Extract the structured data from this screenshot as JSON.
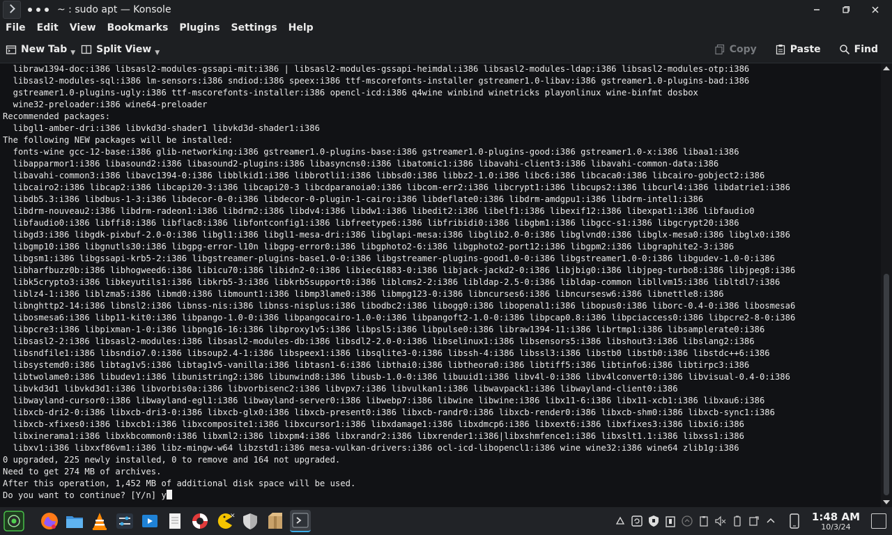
{
  "window": {
    "title": "~ : sudo apt — Konsole"
  },
  "menubar": {
    "items": [
      "File",
      "Edit",
      "View",
      "Bookmarks",
      "Plugins",
      "Settings",
      "Help"
    ]
  },
  "toolbar": {
    "new_tab": "New Tab",
    "split_view": "Split View",
    "copy": "Copy",
    "paste": "Paste",
    "find": "Find"
  },
  "terminal": {
    "lines": [
      "  libraw1394-doc:i386 libsasl2-modules-gssapi-mit:i386 | libsasl2-modules-gssapi-heimdal:i386 libsasl2-modules-ldap:i386 libsasl2-modules-otp:i386",
      "  libsasl2-modules-sql:i386 lm-sensors:i386 sndiod:i386 speex:i386 ttf-mscorefonts-installer gstreamer1.0-libav:i386 gstreamer1.0-plugins-bad:i386",
      "  gstreamer1.0-plugins-ugly:i386 ttf-mscorefonts-installer:i386 opencl-icd:i386 q4wine winbind winetricks playonlinux wine-binfmt dosbox",
      "  wine32-preloader:i386 wine64-preloader",
      "Recommended packages:",
      "  libgl1-amber-dri:i386 libvkd3d-shader1 libvkd3d-shader1:i386",
      "The following NEW packages will be installed:",
      "  fonts-wine gcc-12-base:i386 glib-networking:i386 gstreamer1.0-plugins-base:i386 gstreamer1.0-plugins-good:i386 gstreamer1.0-x:i386 libaa1:i386",
      "  libapparmor1:i386 libasound2:i386 libasound2-plugins:i386 libasyncns0:i386 libatomic1:i386 libavahi-client3:i386 libavahi-common-data:i386",
      "  libavahi-common3:i386 libavc1394-0:i386 libblkid1:i386 libbrotli1:i386 libbsd0:i386 libbz2-1.0:i386 libc6:i386 libcaca0:i386 libcairo-gobject2:i386",
      "  libcairo2:i386 libcap2:i386 libcapi20-3:i386 libcapi20-3 libcdparanoia0:i386 libcom-err2:i386 libcrypt1:i386 libcups2:i386 libcurl4:i386 libdatrie1:i386",
      "  libdb5.3:i386 libdbus-1-3:i386 libdecor-0-0:i386 libdecor-0-plugin-1-cairo:i386 libdeflate0:i386 libdrm-amdgpu1:i386 libdrm-intel1:i386",
      "  libdrm-nouveau2:i386 libdrm-radeon1:i386 libdrm2:i386 libdv4:i386 libdw1:i386 libedit2:i386 libelf1:i386 libexif12:i386 libexpat1:i386 libfaudio0",
      "  libfaudio0:i386 libffi8:i386 libflac8:i386 libfontconfig1:i386 libfreetype6:i386 libfribidi0:i386 libgbm1:i386 libgcc-s1:i386 libgcrypt20:i386",
      "  libgd3:i386 libgdk-pixbuf-2.0-0:i386 libgl1:i386 libgl1-mesa-dri:i386 libglapi-mesa:i386 libglib2.0-0:i386 libglvnd0:i386 libglx-mesa0:i386 libglx0:i386",
      "  libgmp10:i386 libgnutls30:i386 libgpg-error-l10n libgpg-error0:i386 libgphoto2-6:i386 libgphoto2-port12:i386 libgpm2:i386 libgraphite2-3:i386",
      "  libgsm1:i386 libgssapi-krb5-2:i386 libgstreamer-plugins-base1.0-0:i386 libgstreamer-plugins-good1.0-0:i386 libgstreamer1.0-0:i386 libgudev-1.0-0:i386",
      "  libharfbuzz0b:i386 libhogweed6:i386 libicu70:i386 libidn2-0:i386 libiec61883-0:i386 libjack-jackd2-0:i386 libjbig0:i386 libjpeg-turbo8:i386 libjpeg8:i386",
      "  libk5crypto3:i386 libkeyutils1:i386 libkrb5-3:i386 libkrb5support0:i386 liblcms2-2:i386 libldap-2.5-0:i386 libldap-common libllvm15:i386 libltdl7:i386",
      "  liblz4-1:i386 liblzma5:i386 libmd0:i386 libmount1:i386 libmp3lame0:i386 libmpg123-0:i386 libncurses6:i386 libncursesw6:i386 libnettle8:i386",
      "  libnghttp2-14:i386 libnsl2:i386 libnss-nis:i386 libnss-nisplus:i386 libodbc2:i386 libogg0:i386 libopenal1:i386 libopus0:i386 liborc-0.4-0:i386 libosmesa6",
      "  libosmesa6:i386 libp11-kit0:i386 libpango-1.0-0:i386 libpangocairo-1.0-0:i386 libpangoft2-1.0-0:i386 libpcap0.8:i386 libpciaccess0:i386 libpcre2-8-0:i386",
      "  libpcre3:i386 libpixman-1-0:i386 libpng16-16:i386 libproxy1v5:i386 libpsl5:i386 libpulse0:i386 libraw1394-11:i386 librtmp1:i386 libsamplerate0:i386",
      "  libsasl2-2:i386 libsasl2-modules:i386 libsasl2-modules-db:i386 libsdl2-2.0-0:i386 libselinux1:i386 libsensors5:i386 libshout3:i386 libslang2:i386",
      "  libsndfile1:i386 libsndio7.0:i386 libsoup2.4-1:i386 libspeex1:i386 libsqlite3-0:i386 libssh-4:i386 libssl3:i386 libstb0 libstb0:i386 libstdc++6:i386",
      "  libsystemd0:i386 libtag1v5:i386 libtag1v5-vanilla:i386 libtasn1-6:i386 libthai0:i386 libtheora0:i386 libtiff5:i386 libtinfo6:i386 libtirpc3:i386",
      "  libtwolame0:i386 libudev1:i386 libunistring2:i386 libunwind8:i386 libusb-1.0-0:i386 libuuid1:i386 libv4l-0:i386 libv4lconvert0:i386 libvisual-0.4-0:i386",
      "  libvkd3d1 libvkd3d1:i386 libvorbis0a:i386 libvorbisenc2:i386 libvpx7:i386 libvulkan1:i386 libwavpack1:i386 libwayland-client0:i386",
      "  libwayland-cursor0:i386 libwayland-egl1:i386 libwayland-server0:i386 libwebp7:i386 libwine libwine:i386 libx11-6:i386 libx11-xcb1:i386 libxau6:i386",
      "  libxcb-dri2-0:i386 libxcb-dri3-0:i386 libxcb-glx0:i386 libxcb-present0:i386 libxcb-randr0:i386 libxcb-render0:i386 libxcb-shm0:i386 libxcb-sync1:i386",
      "  libxcb-xfixes0:i386 libxcb1:i386 libxcomposite1:i386 libxcursor1:i386 libxdamage1:i386 libxdmcp6:i386 libxext6:i386 libxfixes3:i386 libxi6:i386",
      "  libxinerama1:i386 libxkbcommon0:i386 libxml2:i386 libxpm4:i386 libxrandr2:i386 libxrender1:i386|libxshmfence1:i386 libxslt1.1:i386 libxss1:i386",
      "  libxv1:i386 libxxf86vm1:i386 libz-mingw-w64 libzstd1:i386 mesa-vulkan-drivers:i386 ocl-icd-libopencl1:i386 wine wine32:i386 wine64 zlib1g:i386",
      "0 upgraded, 225 newly installed, 0 to remove and 164 not upgraded.",
      "Need to get 274 MB of archives.",
      "After this operation, 1,452 MB of additional disk space will be used.",
      "Do you want to continue? [Y/n] y"
    ]
  },
  "taskbar": {
    "apps": [
      {
        "name": "app-launcher",
        "icon": "launcher-icon"
      },
      {
        "name": "firefox",
        "icon": "firefox-icon"
      },
      {
        "name": "files",
        "icon": "folder-icon"
      },
      {
        "name": "vlc",
        "icon": "vlc-icon"
      },
      {
        "name": "settings",
        "icon": "sliders-icon"
      },
      {
        "name": "software",
        "icon": "store-icon"
      },
      {
        "name": "text-editor",
        "icon": "document-icon"
      },
      {
        "name": "help",
        "icon": "lifebuoy-icon"
      },
      {
        "name": "game",
        "icon": "pacman-icon"
      },
      {
        "name": "security",
        "icon": "shield-icon"
      },
      {
        "name": "archive",
        "icon": "package-icon"
      },
      {
        "name": "konsole",
        "icon": "terminal-icon"
      }
    ],
    "clock_time": "1:48 AM",
    "clock_date": "10/3/24"
  },
  "colors": {
    "background": "#111215",
    "chrome": "#1d1f22",
    "text": "#e8e8e8",
    "accent": "#3daee9"
  }
}
